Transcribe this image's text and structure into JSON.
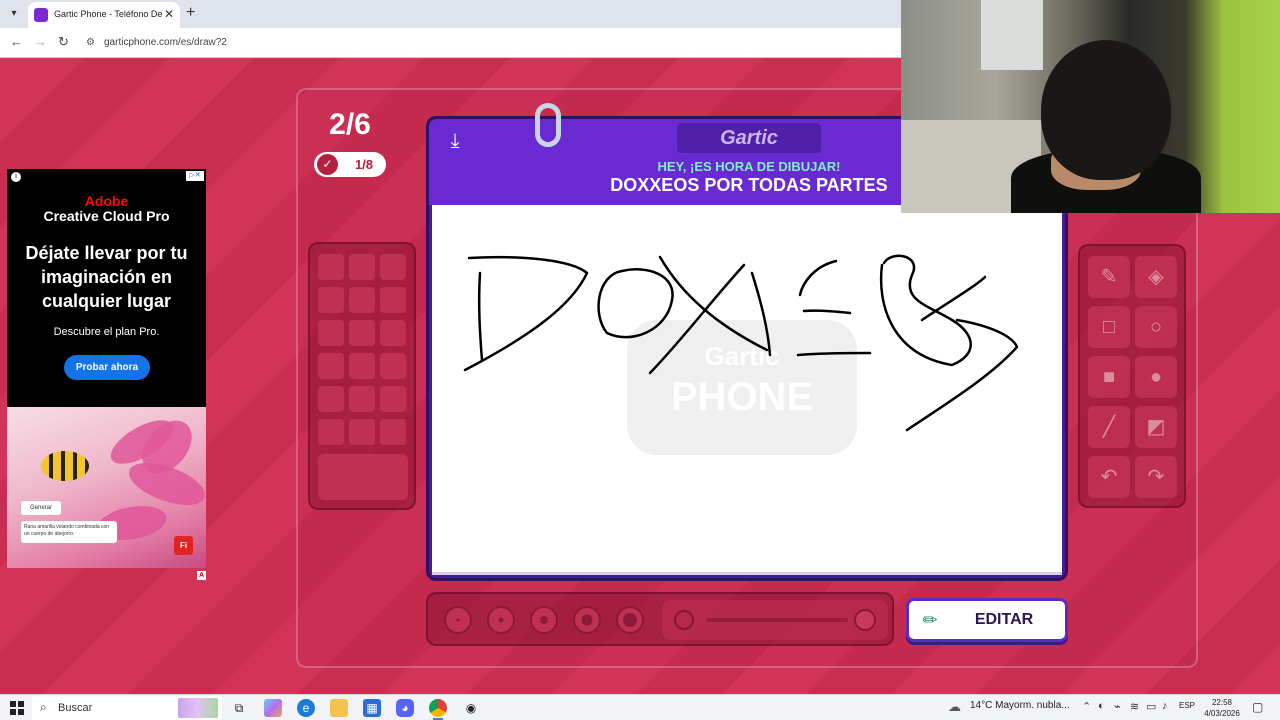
{
  "browser": {
    "tab_title": "Gartic Phone - Teléfono Descon",
    "url": "garticphone.com/es/draw?2",
    "new_tab": "+",
    "close": "✕"
  },
  "ad": {
    "brand": "Adobe",
    "product": "Creative Cloud Pro",
    "headline": "Déjate llevar por tu imaginación en cualquier lugar",
    "subline": "Descubre el plan Pro.",
    "cta": "Probar ahora",
    "generate_label": "Generar",
    "prompt_text": "Rana amarilla volando combinada con un cuerpo de abejorro.",
    "logo": "Fi",
    "corner_badge": "A"
  },
  "game": {
    "turn": "2/6",
    "progress": "1/8",
    "logo": "Gartic",
    "prompt_title": "HEY, ¡ES HORA DE DIBUJAR!",
    "prompt_text": "DOXXEOS POR TODAS PARTES",
    "edit_button": "EDITAR",
    "watermark_top": "Gartic",
    "watermark_bottom": "PHONE"
  },
  "tools": {
    "icons": [
      "pencil-icon",
      "eraser-icon",
      "square-outline-icon",
      "circle-outline-icon",
      "square-filled-icon",
      "circle-filled-icon",
      "line-icon",
      "fill-bucket-icon",
      "undo-icon",
      "redo-icon"
    ]
  },
  "colors": {
    "accent": "#6a2ad1",
    "prompt_title": "#7ef0c6",
    "background": "#d23556"
  },
  "taskbar": {
    "search_placeholder": "Buscar",
    "weather": "14°C  Mayorm. nubla...",
    "language": "ESP",
    "time": "22:58",
    "date": "4/03/2026"
  }
}
